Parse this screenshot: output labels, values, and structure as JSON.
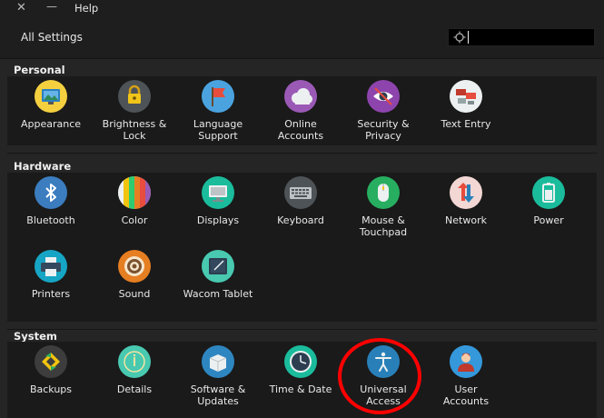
{
  "window": {
    "title": "Help"
  },
  "toolbar": {
    "all_settings_label": "All Settings",
    "search_value": ""
  },
  "sections": {
    "personal": {
      "title": "Personal",
      "items": [
        {
          "label": "Appearance",
          "icon": "appearance-icon"
        },
        {
          "label": "Brightness &\nLock",
          "icon": "brightness-lock-icon"
        },
        {
          "label": "Language\nSupport",
          "icon": "language-flag-icon"
        },
        {
          "label": "Online\nAccounts",
          "icon": "cloud-icon"
        },
        {
          "label": "Security &\nPrivacy",
          "icon": "eye-icon"
        },
        {
          "label": "Text Entry",
          "icon": "keyboard-layout-icon"
        }
      ]
    },
    "hardware": {
      "title": "Hardware",
      "items": [
        {
          "label": "Bluetooth",
          "icon": "bluetooth-icon"
        },
        {
          "label": "Color",
          "icon": "color-stripes-icon"
        },
        {
          "label": "Displays",
          "icon": "monitor-icon"
        },
        {
          "label": "Keyboard",
          "icon": "keyboard-icon"
        },
        {
          "label": "Mouse &\nTouchpad",
          "icon": "mouse-icon"
        },
        {
          "label": "Network",
          "icon": "network-arrows-icon"
        },
        {
          "label": "Power",
          "icon": "battery-icon"
        },
        {
          "label": "Printers",
          "icon": "printer-icon"
        },
        {
          "label": "Sound",
          "icon": "speaker-icon"
        },
        {
          "label": "Wacom Tablet",
          "icon": "tablet-icon"
        }
      ]
    },
    "system": {
      "title": "System",
      "items": [
        {
          "label": "Backups",
          "icon": "backup-icon"
        },
        {
          "label": "Details",
          "icon": "info-icon"
        },
        {
          "label": "Software &\nUpdates",
          "icon": "package-icon"
        },
        {
          "label": "Time & Date",
          "icon": "clock-icon"
        },
        {
          "label": "Universal\nAccess",
          "icon": "accessibility-icon"
        },
        {
          "label": "User\nAccounts",
          "icon": "user-icon"
        }
      ]
    }
  },
  "annotation": {
    "color": "#ff0000",
    "target": "universal-access"
  }
}
